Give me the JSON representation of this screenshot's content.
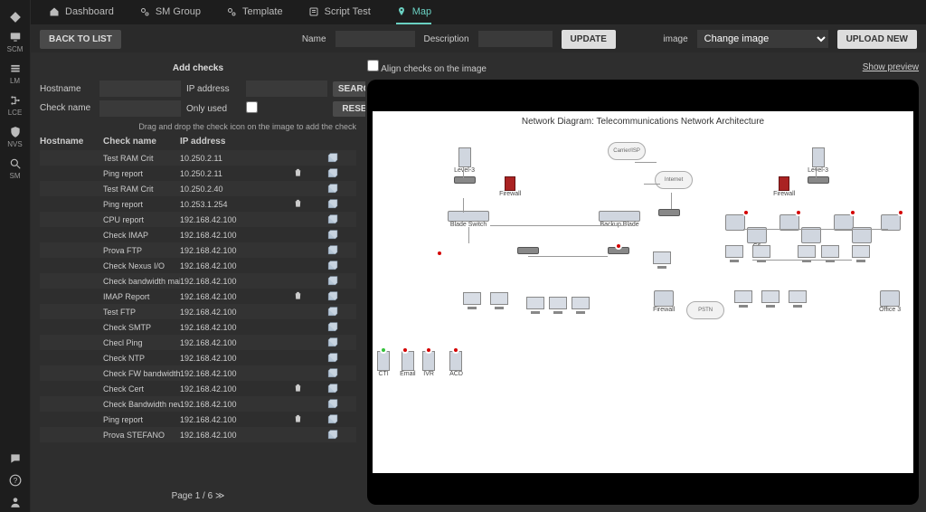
{
  "sidebar": {
    "items": [
      {
        "icon": "monitor",
        "label": "SCM"
      },
      {
        "icon": "list",
        "label": "LM"
      },
      {
        "icon": "branch",
        "label": "LCE"
      },
      {
        "icon": "shield",
        "label": "NVS"
      },
      {
        "icon": "search",
        "label": "SM"
      }
    ],
    "bottom": [
      {
        "icon": "chat",
        "label": ""
      },
      {
        "icon": "help",
        "label": ""
      },
      {
        "icon": "user",
        "label": ""
      }
    ]
  },
  "tabs": [
    {
      "icon": "home",
      "label": "Dashboard"
    },
    {
      "icon": "cogs",
      "label": "SM Group"
    },
    {
      "icon": "cogs",
      "label": "Template"
    },
    {
      "icon": "script",
      "label": "Script Test"
    },
    {
      "icon": "pin",
      "label": "Map"
    }
  ],
  "active_tab_index": 4,
  "toolbar": {
    "back_label": "BACK TO LIST",
    "name_label": "Name",
    "desc_label": "Description",
    "update_label": "UPDATE",
    "image_label": "image",
    "change_image_placeholder": "Change image",
    "upload_label": "UPLOAD NEW"
  },
  "filters": {
    "title": "Add checks",
    "hostname_label": "Hostname",
    "ip_label": "IP address",
    "search_label": "SEARCH",
    "checkname_label": "Check name",
    "onlyused_label": "Only used",
    "reset_label": "RESET",
    "hint": "Drag and drop the check icon on the image to add the check"
  },
  "table": {
    "headers": {
      "hostname": "Hostname",
      "checkname": "Check name",
      "ipaddress": "IP address"
    },
    "rows": [
      {
        "name": "Test RAM Crit",
        "ip": "10.250.2.11",
        "trash": false
      },
      {
        "name": "Ping report",
        "ip": "10.250.2.11",
        "trash": true
      },
      {
        "name": "Test RAM Crit",
        "ip": "10.250.2.40",
        "trash": false
      },
      {
        "name": "Ping report",
        "ip": "10.253.1.254",
        "trash": true
      },
      {
        "name": "CPU report",
        "ip": "192.168.42.100",
        "trash": false
      },
      {
        "name": "Check IMAP",
        "ip": "192.168.42.100",
        "trash": false
      },
      {
        "name": "Prova FTP",
        "ip": "192.168.42.100",
        "trash": false
      },
      {
        "name": "Check Nexus I/O",
        "ip": "192.168.42.100",
        "trash": false
      },
      {
        "name": "Check bandwidth mail",
        "ip": "192.168.42.100",
        "trash": false
      },
      {
        "name": "IMAP Report",
        "ip": "192.168.42.100",
        "trash": true
      },
      {
        "name": "Test FTP",
        "ip": "192.168.42.100",
        "trash": false
      },
      {
        "name": "Check SMTP",
        "ip": "192.168.42.100",
        "trash": false
      },
      {
        "name": "Checl Ping",
        "ip": "192.168.42.100",
        "trash": false
      },
      {
        "name": "Check NTP",
        "ip": "192.168.42.100",
        "trash": false
      },
      {
        "name": "Check FW bandwidth",
        "ip": "192.168.42.100",
        "trash": false
      },
      {
        "name": "Check Cert",
        "ip": "192.168.42.100",
        "trash": true
      },
      {
        "name": "Check Bandwidth new",
        "ip": "192.168.42.100",
        "trash": false
      },
      {
        "name": "Ping report",
        "ip": "192.168.42.100",
        "trash": true
      },
      {
        "name": "Prova STEFANO",
        "ip": "192.168.42.100",
        "trash": false
      }
    ],
    "pager": "Page 1 / 6",
    "next_symbol": "≫"
  },
  "right": {
    "align_label": "Align checks on the image",
    "show_preview": "Show preview",
    "diagram_title": "Network Diagram: Telecommunications Network Architecture"
  }
}
